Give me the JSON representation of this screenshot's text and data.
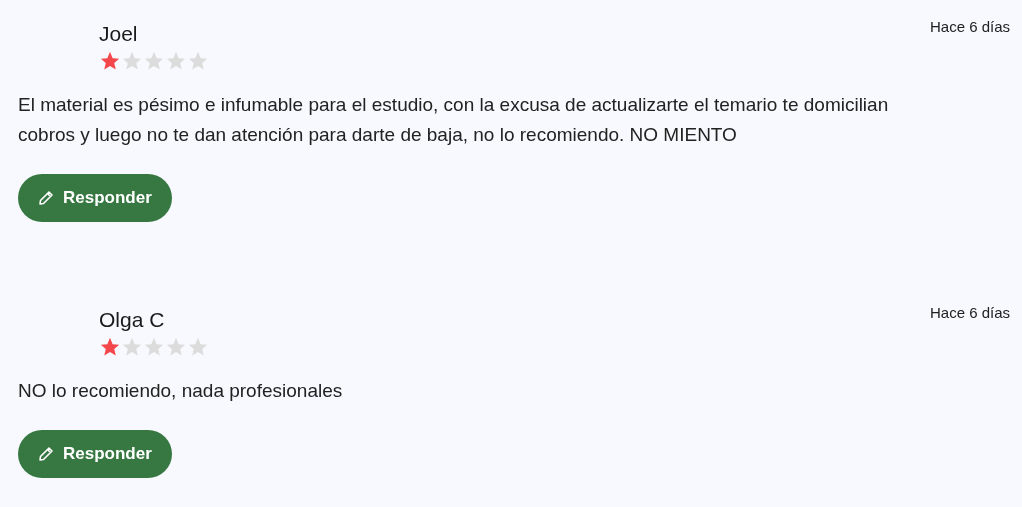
{
  "reviews": [
    {
      "name": "Joel",
      "stars": 1,
      "date": "Hace 6 días",
      "text": "El material es pésimo e infumable para el estudio, con la excusa de actualizarte el temario te domicilian cobros y luego no te dan atención para darte de baja, no lo recomiendo. NO MIENTO",
      "button": "Responder"
    },
    {
      "name": "Olga C",
      "stars": 1,
      "date": "Hace 6 días",
      "text": "NO lo recomiendo, nada profesionales",
      "button": "Responder"
    }
  ]
}
